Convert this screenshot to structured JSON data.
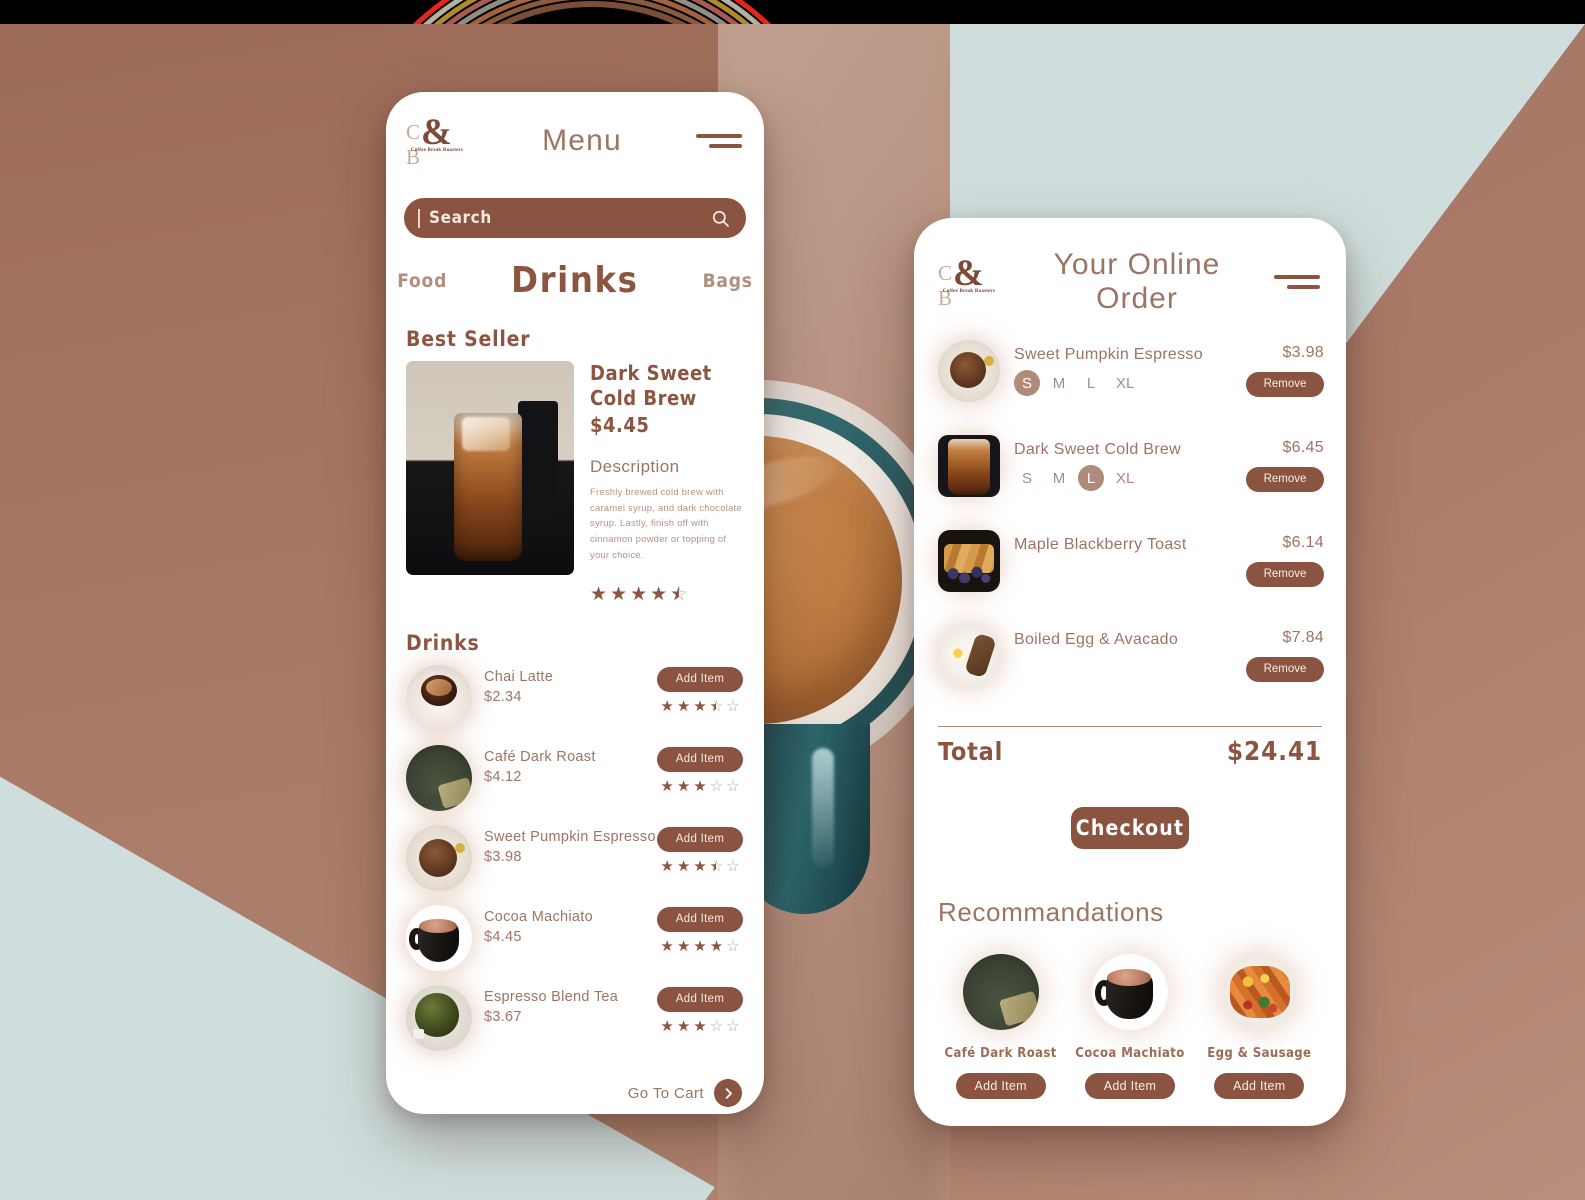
{
  "brand": {
    "mark": "C   B",
    "ampersand": "&",
    "tagline": "Coffee Break Roasters",
    "accent_brown": "#8a5440",
    "muted_brown": "#9b7565",
    "light_brown": "#b08a7a",
    "mint": "#cfdedd",
    "mocha": "#a87a66"
  },
  "menu_screen": {
    "title": "Menu",
    "menu_icon": "hamburger-icon",
    "search": {
      "placeholder": "Search",
      "value": "",
      "icon": "search-icon"
    },
    "tabs": [
      {
        "label": "Food",
        "active": false
      },
      {
        "label": "Drinks",
        "active": true
      },
      {
        "label": "Bags",
        "active": false
      }
    ],
    "best_seller": {
      "section_label": "Best Seller",
      "name": "Dark Sweet Cold Brew",
      "price": "$4.45",
      "description_label": "Description",
      "description": "Freshly brewed cold brew with caramel syrup, and dark chocolate syrup. Lastly, finish off with cinnamon powder or topping of your choice.",
      "rating": 4.5,
      "image_alt": "iced-cold-brew-glass-photo"
    },
    "drinks_section_label": "Drinks",
    "drinks": [
      {
        "name": "Chai Latte",
        "price": "$2.34",
        "rating": 3.5,
        "button": "Add Item",
        "art": "cup-white"
      },
      {
        "name": "Café Dark Roast",
        "price": "$4.12",
        "rating": 3,
        "button": "Add Item",
        "art": "cup-dark"
      },
      {
        "name": "Sweet Pumpkin Espresso",
        "price": "$3.98",
        "rating": 3.5,
        "button": "Add Item",
        "art": "pumpkin"
      },
      {
        "name": "Cocoa Machiato",
        "price": "$4.45",
        "rating": 4,
        "button": "Add Item",
        "art": "cocoa"
      },
      {
        "name": "Espresso Blend Tea",
        "price": "$3.67",
        "rating": 3,
        "button": "Add Item",
        "art": "tea"
      }
    ],
    "go_to_cart": {
      "label": "Go To Cart",
      "icon": "chevron-right-icon"
    }
  },
  "order_screen": {
    "title": "Your Online Order",
    "menu_icon": "hamburger-icon",
    "items": [
      {
        "name": "Sweet Pumpkin Espresso",
        "price": "$3.98",
        "sizes": [
          "S",
          "M",
          "L",
          "XL"
        ],
        "selected_size": "S",
        "remove_label": "Remove",
        "art": "pumpkin"
      },
      {
        "name": "Dark Sweet Cold Brew",
        "price": "$6.45",
        "sizes": [
          "S",
          "M",
          "L",
          "XL"
        ],
        "selected_size": "L",
        "remove_label": "Remove",
        "art": "coldbrew"
      },
      {
        "name": "Maple Blackberry Toast",
        "price": "$6.14",
        "sizes": [],
        "selected_size": "",
        "remove_label": "Remove",
        "art": "toast"
      },
      {
        "name": "Boiled Egg & Avacado",
        "price": "$7.84",
        "sizes": [],
        "selected_size": "",
        "remove_label": "Remove",
        "art": "eggplate"
      }
    ],
    "total_label": "Total",
    "total_value": "$24.41",
    "checkout_label": "Checkout",
    "recommendations_label": "Recommandations",
    "recommendations": [
      {
        "name": "Café Dark Roast",
        "button": "Add Item",
        "art": "cup-dark"
      },
      {
        "name": "Cocoa Machiato",
        "button": "Add Item",
        "art": "cocoa"
      },
      {
        "name": "Egg & Sausage",
        "button": "Add Item",
        "art": "sausage"
      }
    ]
  }
}
